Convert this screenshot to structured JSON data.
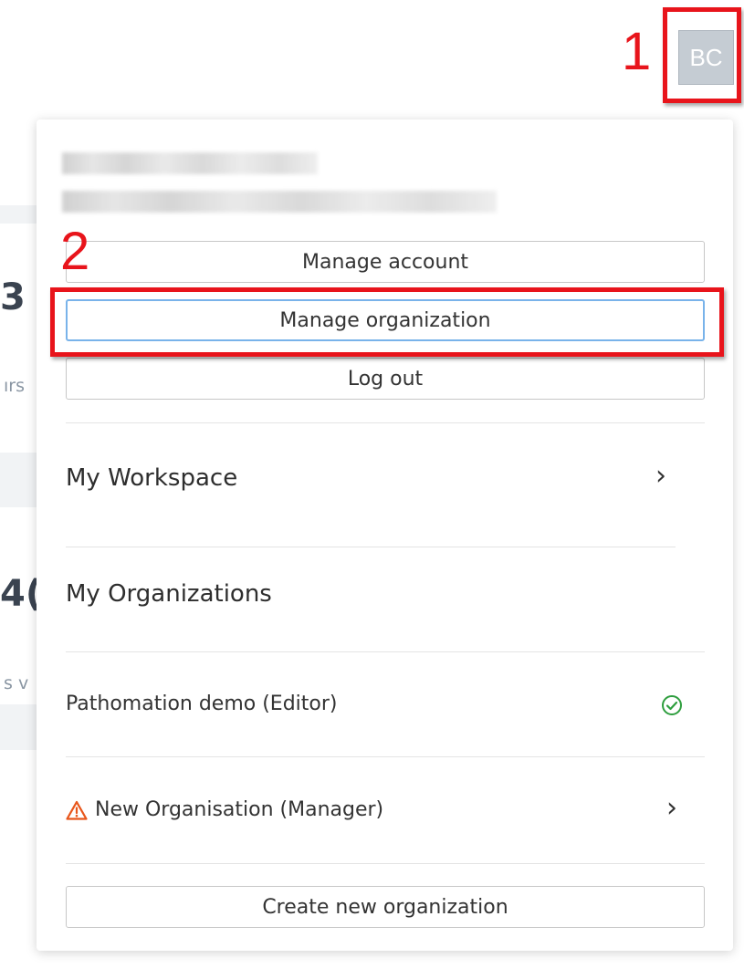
{
  "annotations": {
    "step1": "1",
    "step2": "2"
  },
  "avatar": {
    "initials": "BC"
  },
  "background": {
    "frag_1": "3",
    "frag_2": "ırs",
    "frag_3": "4(",
    "frag_4": "s v"
  },
  "menu": {
    "manage_account": "Manage account",
    "manage_organization": "Manage organization",
    "log_out": "Log out",
    "my_workspace": "My Workspace",
    "my_organizations": "My Organizations",
    "organizations": [
      {
        "label": "Pathomation demo (Editor)",
        "status": "check-circle-icon"
      },
      {
        "label": "New Organisation (Manager)",
        "status": "warning-icon"
      }
    ],
    "create_new": "Create new organization"
  },
  "colors": {
    "highlight": "#e8141b",
    "success": "#2e9e3e",
    "warning": "#e8561b",
    "focus": "#79b3ea"
  }
}
